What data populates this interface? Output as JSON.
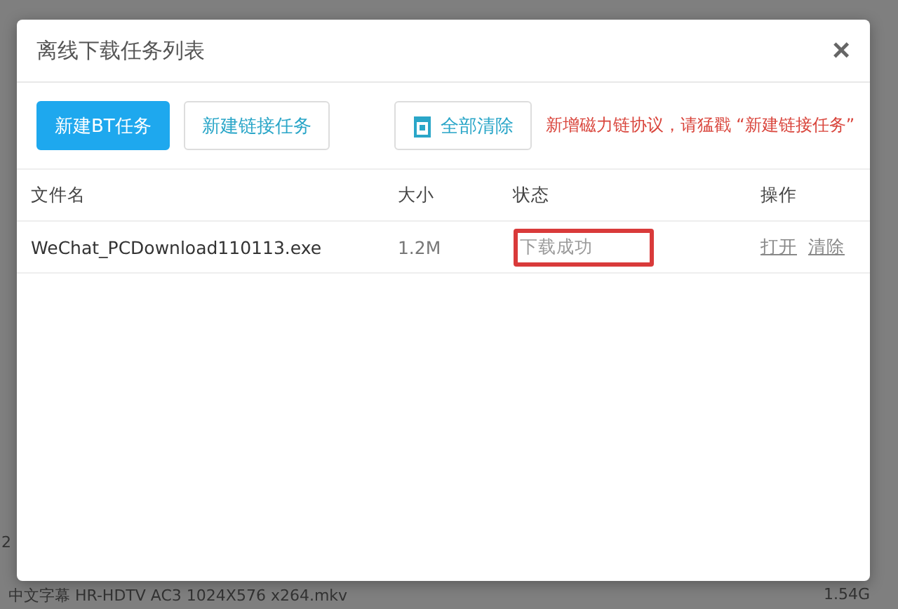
{
  "background": {
    "texts": [
      "2"
    ],
    "bottom_row": {
      "name": "中文字幕 HR-HDTV AC3 1024X576 x264.mkv",
      "size": "1.54G"
    }
  },
  "dialog": {
    "title": "离线下载任务列表",
    "close": "×",
    "buttons": [
      {
        "label": "新建BT任务",
        "kind": "primary"
      },
      {
        "label": "新建链接任务",
        "kind": "outline"
      },
      {
        "label": "全部清除",
        "kind": "clear"
      }
    ],
    "notice": "新增磁力链协议，请猛戳 “新建链接任务”",
    "table": {
      "columns": [
        "文件名",
        "大小",
        "状态",
        "操作"
      ],
      "rows": [
        {
          "name": "WeChat_PCDownload110113.exe",
          "size": "1.2M",
          "status": "下载成功",
          "highlighted": true,
          "actions": [
            "打开",
            "清除"
          ]
        }
      ]
    }
  }
}
